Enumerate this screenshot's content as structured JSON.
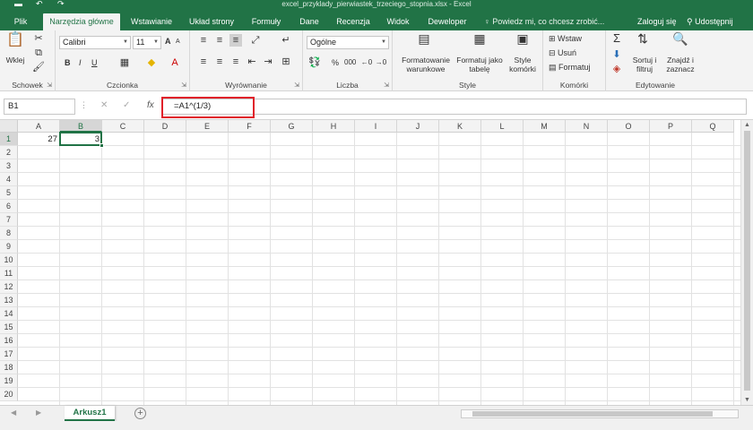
{
  "window": {
    "title": "excel_przyklady_pierwiastek_trzeciego_stopnia.xlsx - Excel"
  },
  "tabs": [
    {
      "label": "Plik",
      "active": false
    },
    {
      "label": "Narzędzia główne",
      "active": true
    },
    {
      "label": "Wstawianie",
      "active": false
    },
    {
      "label": "Układ strony",
      "active": false
    },
    {
      "label": "Formuły",
      "active": false
    },
    {
      "label": "Dane",
      "active": false
    },
    {
      "label": "Recenzja",
      "active": false
    },
    {
      "label": "Widok",
      "active": false
    },
    {
      "label": "Deweloper",
      "active": false
    }
  ],
  "tell_me": "Powiedz mi, co chcesz zrobić...",
  "login": "Zaloguj się",
  "share": "Udostępnij",
  "ribbon": {
    "clipboard": {
      "label": "Schowek",
      "paste": "Wklej"
    },
    "font": {
      "label": "Czcionka",
      "name": "Calibri",
      "size": "11",
      "bold": "B",
      "italic": "I",
      "underline": "U",
      "grow": "A",
      "shrink": "A"
    },
    "alignment": {
      "label": "Wyrównanie"
    },
    "number": {
      "label": "Liczba",
      "format": "Ogólne",
      "percent": "%",
      "comma": "000"
    },
    "styles": {
      "label": "Style",
      "cond_format": [
        "Formatowanie",
        "warunkowe"
      ],
      "table_format": [
        "Formatuj jako",
        "tabelę"
      ],
      "cell_styles": [
        "Style",
        "komórki"
      ]
    },
    "cells": {
      "label": "Komórki",
      "insert": "Wstaw",
      "delete": "Usuń",
      "format": "Formatuj"
    },
    "editing": {
      "label": "Edytowanie",
      "sort": [
        "Sortuj i",
        "filtruj"
      ],
      "find": [
        "Znajdź i",
        "zaznacz"
      ]
    }
  },
  "formula_bar": {
    "name_box": "B1",
    "fx": "fx",
    "formula": "=A1^(1/3)"
  },
  "grid": {
    "columns": [
      "A",
      "B",
      "C",
      "D",
      "E",
      "F",
      "G",
      "H",
      "I",
      "J",
      "K",
      "L",
      "M",
      "N",
      "O",
      "P",
      "Q"
    ],
    "rows": [
      "1",
      "2",
      "3",
      "4",
      "5",
      "6",
      "7",
      "8",
      "9",
      "10",
      "11",
      "12",
      "13",
      "14",
      "15",
      "16",
      "17",
      "18",
      "19",
      "20"
    ],
    "selected_column": "B",
    "selected_row": "1",
    "cells": {
      "A1": "27",
      "B1": "3"
    }
  },
  "sheets": [
    {
      "label": "Arkusz1",
      "active": true
    }
  ],
  "accent_color": "#217346",
  "highlight_color": "#e0212a"
}
